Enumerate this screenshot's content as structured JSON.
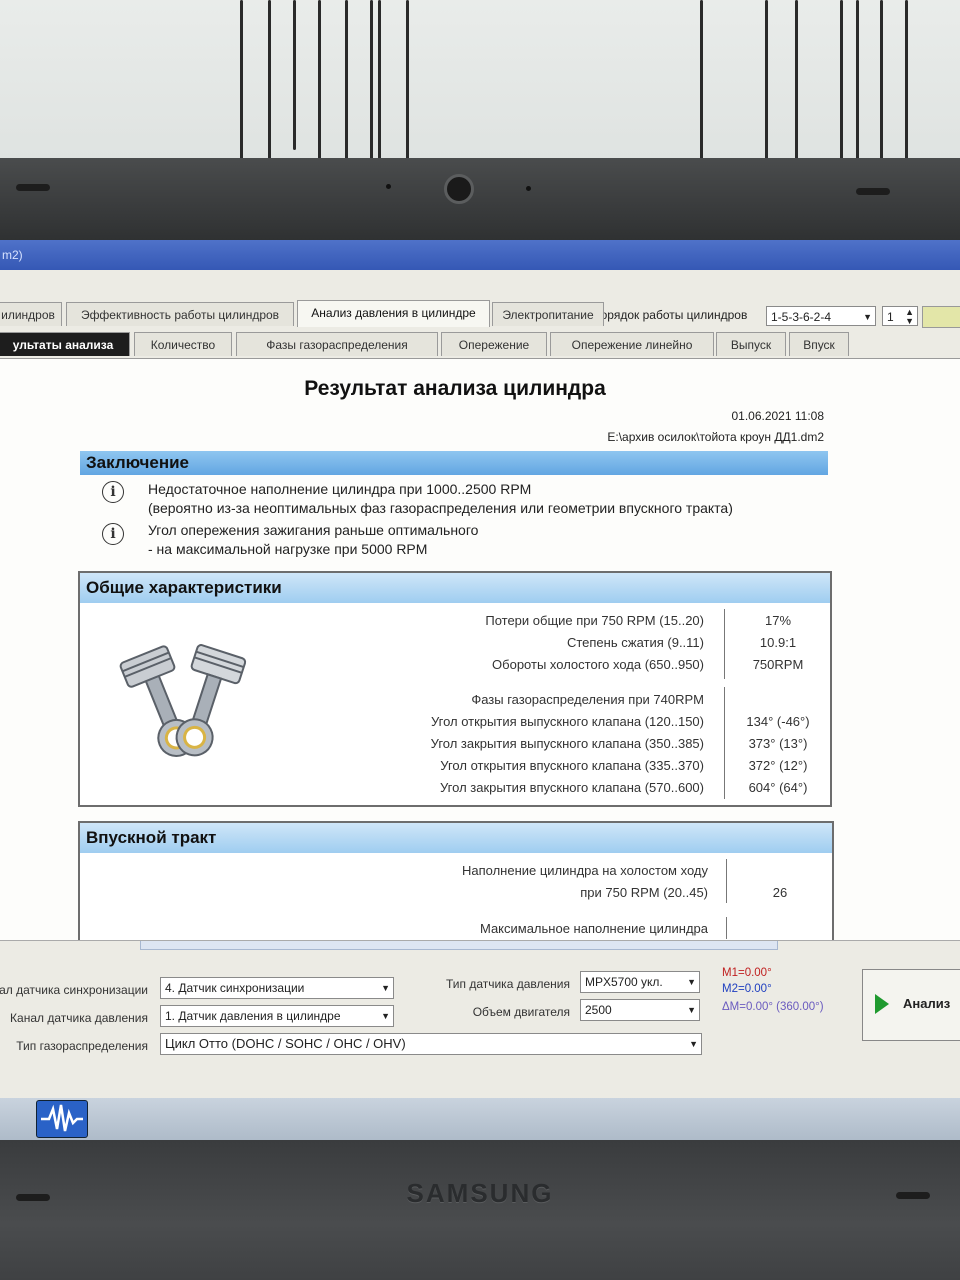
{
  "window": {
    "title_fragment": "m2)"
  },
  "cylinder_order": {
    "label": "Порядок работы цилиндров",
    "value": "1-5-3-6-2-4",
    "number": "1"
  },
  "tabs_main": [
    {
      "label": "илиндров"
    },
    {
      "label": "Эффективность работы цилиндров"
    },
    {
      "label": "Анализ давления в цилиндре"
    },
    {
      "label": "Электропитание"
    }
  ],
  "tabs_sub": [
    {
      "label": "ультаты анализа"
    },
    {
      "label": "Количество"
    },
    {
      "label": "Фазы газораспределения"
    },
    {
      "label": "Опережение"
    },
    {
      "label": "Опережение линейно"
    },
    {
      "label": "Выпуск"
    },
    {
      "label": "Впуск"
    }
  ],
  "report": {
    "title": "Результат анализа цилиндра",
    "date": "01.06.2021 11:08",
    "file": "E:\\архив осилок\\тойота кроун ДД1.dm2",
    "conclusion": {
      "header": "Заключение",
      "items": [
        {
          "line1": "Недостаточное наполнение цилиндра при 1000..2500 RPM",
          "line2": "(вероятно из-за неоптимальных фаз газораспределения или геометрии впускного тракта)"
        },
        {
          "line1": "Угол опережения зажигания раньше оптимального",
          "line2": "- на максимальной нагрузке при 5000 RPM"
        }
      ]
    },
    "general": {
      "header": "Общие характеристики",
      "rows": [
        {
          "label": "Потери общие при 750 RPM (15..20)",
          "value": "17%"
        },
        {
          "label": "Степень сжатия (9..11)",
          "value": "10.9:1"
        },
        {
          "label": "Обороты холостого хода (650..950)",
          "value": "750RPM"
        }
      ],
      "phases_label": "Фазы газораспределения при 740RPM",
      "phases": [
        {
          "label": "Угол открытия выпускного клапана (120..150)",
          "value": "134° (-46°)"
        },
        {
          "label": "Угол закрытия выпускного клапана (350..385)",
          "value": "373° (13°)"
        },
        {
          "label": "Угол открытия впускного клапана (335..370)",
          "value": "372° (12°)"
        },
        {
          "label": "Угол закрытия впускного клапана (570..600)",
          "value": "604° (64°)"
        }
      ]
    },
    "intake": {
      "header": "Впускной тракт",
      "fill_label_1": "Наполнение цилиндра на холостом ходу",
      "fill_label_2": "при 750 RPM (20..45)",
      "fill_value": "26",
      "max_label": "Максимальное наполнение цилиндра"
    }
  },
  "settings": {
    "sync_label": "Канал датчика синхронизации",
    "sync_value": "4. Датчик синхронизации",
    "pressure_channel_label": "Канал датчика давления",
    "pressure_channel_value": "1. Датчик давления в цилиндре",
    "timing_label": "Тип газораспределения",
    "timing_value": "Цикл Отто (DOHC / SOHC / OHC / OHV)",
    "sensor_type_label": "Тип датчика давления",
    "sensor_type_value": "MPX5700 укл.",
    "volume_label": "Объем двигателя",
    "volume_value": "2500",
    "m1": "M1=0.00°",
    "m2": "M2=0.00°",
    "dm": "ΔM=0.00° (360.00°)",
    "analyze_label": "Анализ"
  },
  "bezel": {
    "brand": "SAMSUNG"
  },
  "colors": {
    "section_blue": "#62a6e2",
    "title_blue": "#3558b5",
    "marker_red": "#c02020",
    "marker_blue": "#2040c0",
    "play_green": "#1f9a2f"
  }
}
